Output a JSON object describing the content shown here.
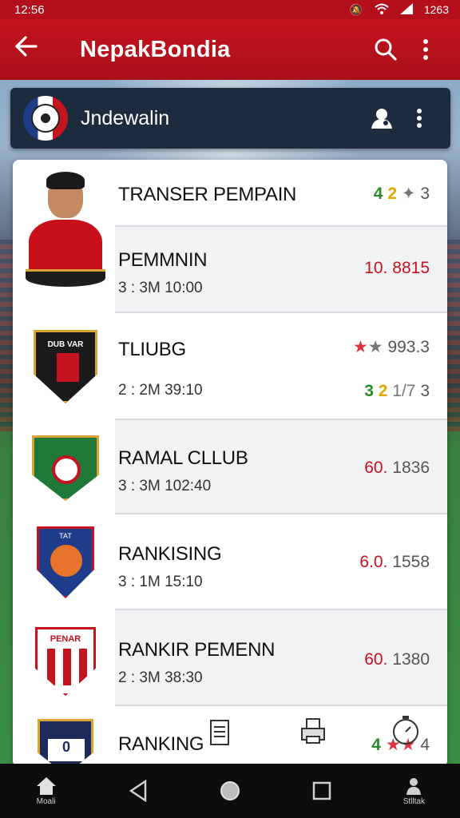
{
  "status_bar": {
    "time": "12:56",
    "battery": "1263"
  },
  "app_bar": {
    "title": "NepakBondia"
  },
  "sub_header": {
    "name": "Jndewalin"
  },
  "colors": {
    "primary": "#c4141f",
    "dark_header": "#1c2b3d",
    "green": "#2a8a2a",
    "yellow": "#e0a800"
  },
  "rows": [
    {
      "title": "TRANSER PEMPAIN",
      "value_a": "4",
      "value_b": "2",
      "value_c": "3",
      "icon": "player-photo"
    },
    {
      "title": "PEMMNIN",
      "subtitle": "3 : 3M 10:00",
      "value": "10. 8815",
      "icon": "player-photo"
    },
    {
      "title": "TLIUBG",
      "subtitle": "2 : 2M 39:10",
      "value_top": "993.3",
      "value_a": "3",
      "value_b": "2",
      "value_c": "1/7",
      "value_d": "3",
      "icon": "club-crest-black"
    },
    {
      "title": "RAMAL CLLUB",
      "subtitle": "3 : 3M 102:40",
      "value_a": "60.",
      "value_b": "1836",
      "icon": "club-crest-green"
    },
    {
      "title": "RANKISING",
      "subtitle": "3 : 1M 15:10",
      "value_a": "6.0.",
      "value_b": "1558",
      "icon": "club-crest-blue"
    },
    {
      "title": "RANKIR PEMENN",
      "subtitle": "2 : 3M 38:30",
      "value_a": "60.",
      "value_b": "1380",
      "icon": "club-crest-red"
    },
    {
      "title": "RANKING",
      "value_a": "4",
      "value_b": "4",
      "icon": "club-crest-navy"
    }
  ],
  "nav": {
    "home_label": "Moali",
    "profile_label": "Stlltak"
  },
  "misc": {
    "crest_text": "DUB VAR",
    "crest_text2": "PENAR",
    "badge_text": "0",
    "crest_text3": "TAT"
  }
}
